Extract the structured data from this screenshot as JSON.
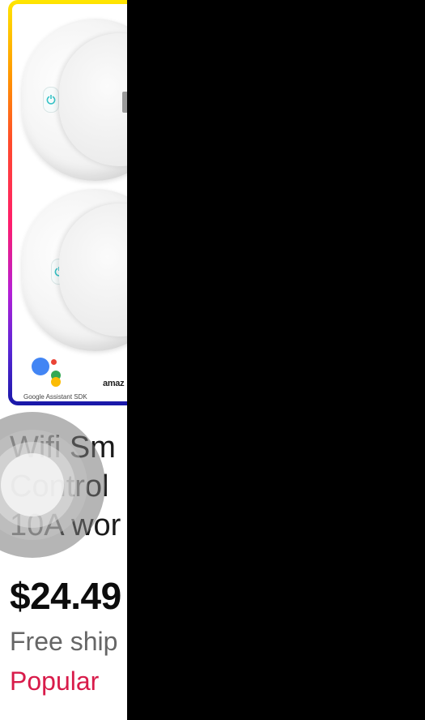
{
  "product": {
    "image_brands": {
      "google_caption": "Google Assistant SDK",
      "amazon_partial": "amaz"
    },
    "title_lines": [
      "Wifi Sm",
      "Control",
      "10A wor"
    ],
    "price": "$24.49",
    "shipping": "Free ship",
    "badge": "Popular"
  },
  "colors": {
    "badge": "#d81b4a",
    "frame_gradient": [
      "#ffe600",
      "#ff9a00",
      "#ff4b2b",
      "#ff1d6b",
      "#b51fd6",
      "#5a26d6",
      "#1818a8"
    ],
    "redaction": "#000000"
  },
  "icons": [
    "power-icon",
    "google-assistant-logo",
    "amazon-logo",
    "assistive-touch-button"
  ]
}
